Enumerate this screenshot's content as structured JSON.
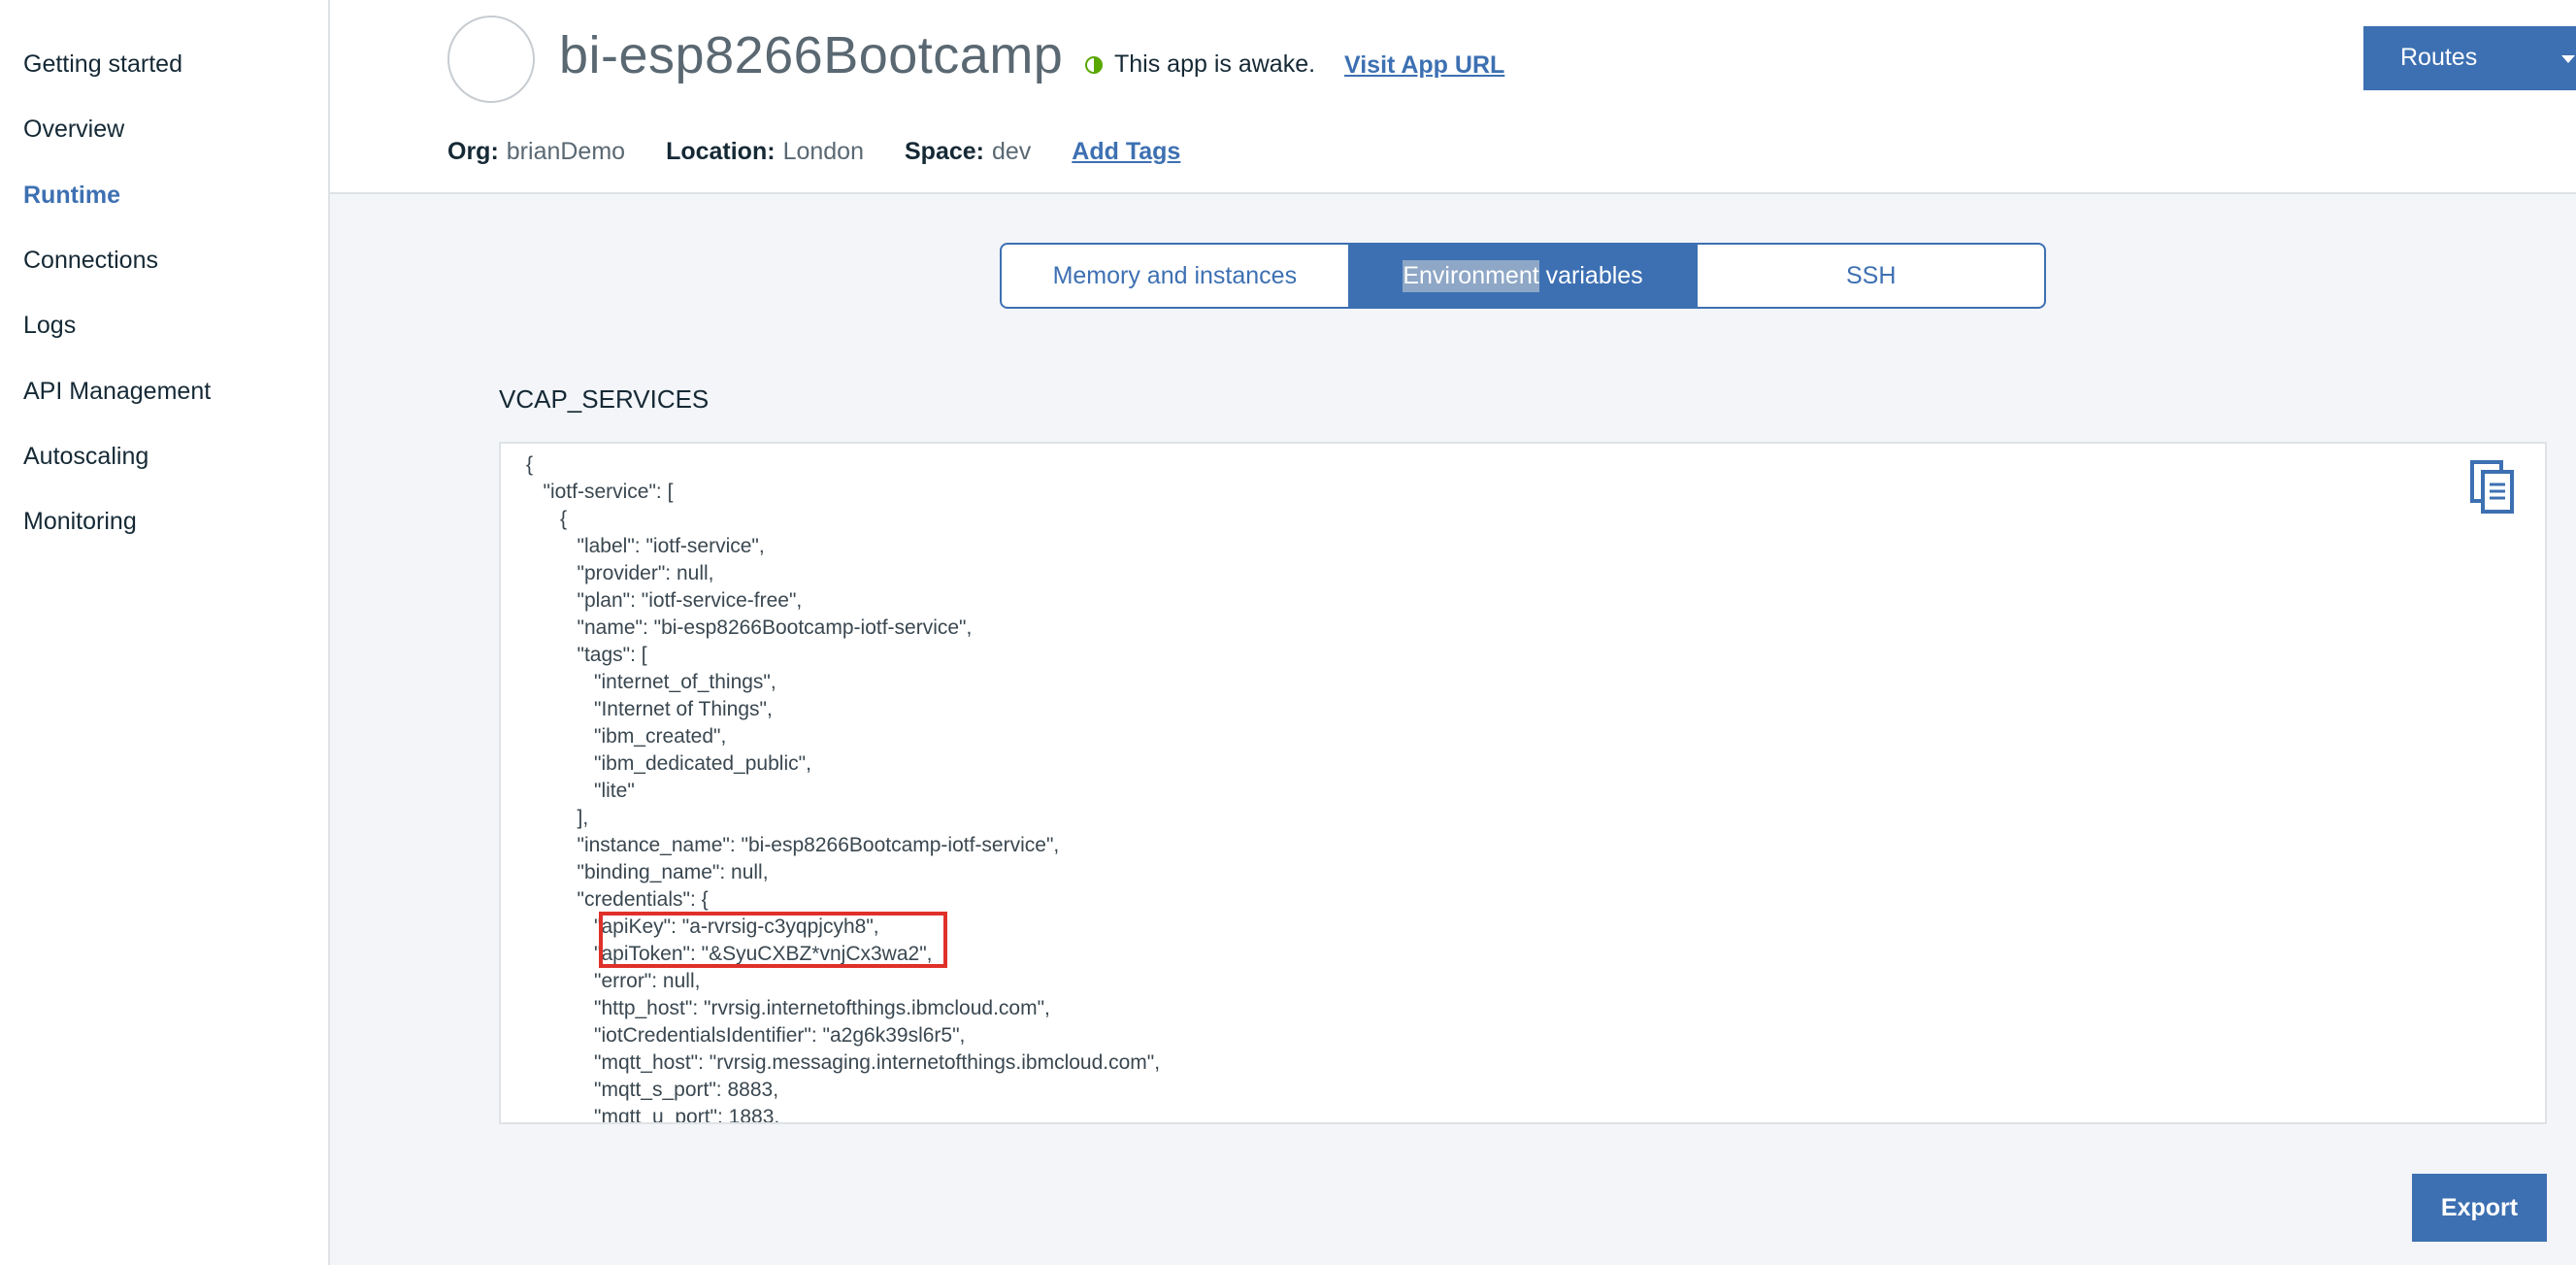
{
  "sidebar": {
    "items": [
      {
        "label": "Getting started",
        "active": false
      },
      {
        "label": "Overview",
        "active": false
      },
      {
        "label": "Runtime",
        "active": true
      },
      {
        "label": "Connections",
        "active": false
      },
      {
        "label": "Logs",
        "active": false
      },
      {
        "label": "API Management",
        "active": false
      },
      {
        "label": "Autoscaling",
        "active": false
      },
      {
        "label": "Monitoring",
        "active": false
      }
    ]
  },
  "header": {
    "app_name": "bi-esp8266Bootcamp",
    "status_text": "This app is awake.",
    "visit_link": "Visit App URL",
    "routes_label": "Routes",
    "org_key": "Org:",
    "org_value": "brianDemo",
    "location_key": "Location:",
    "location_value": "London",
    "space_key": "Space:",
    "space_value": "dev",
    "add_tags": "Add Tags"
  },
  "tabs": {
    "memory": "Memory and instances",
    "env_selected_part": "Environment",
    "env_rest": " variables",
    "ssh": "SSH"
  },
  "section": {
    "title": "VCAP_SERVICES",
    "code": "{\n   \"iotf-service\": [\n      {\n         \"label\": \"iotf-service\",\n         \"provider\": null,\n         \"plan\": \"iotf-service-free\",\n         \"name\": \"bi-esp8266Bootcamp-iotf-service\",\n         \"tags\": [\n            \"internet_of_things\",\n            \"Internet of Things\",\n            \"ibm_created\",\n            \"ibm_dedicated_public\",\n            \"lite\"\n         ],\n         \"instance_name\": \"bi-esp8266Bootcamp-iotf-service\",\n         \"binding_name\": null,\n         \"credentials\": {\n            \"apiKey\": \"a-rvrsig-c3yqpjcyh8\",\n            \"apiToken\": \"&SyuCXBZ*vnjCx3wa2\",\n            \"error\": null,\n            \"http_host\": \"rvrsig.internetofthings.ibmcloud.com\",\n            \"iotCredentialsIdentifier\": \"a2g6k39sl6r5\",\n            \"mqtt_host\": \"rvrsig.messaging.internetofthings.ibmcloud.com\",\n            \"mqtt_s_port\": 8883,\n            \"mqtt_u_port\": 1883,"
  },
  "export_label": "Export",
  "colors": {
    "accent": "#3d70b2",
    "status_green": "#5aa700",
    "highlight_red": "#e0302a"
  }
}
